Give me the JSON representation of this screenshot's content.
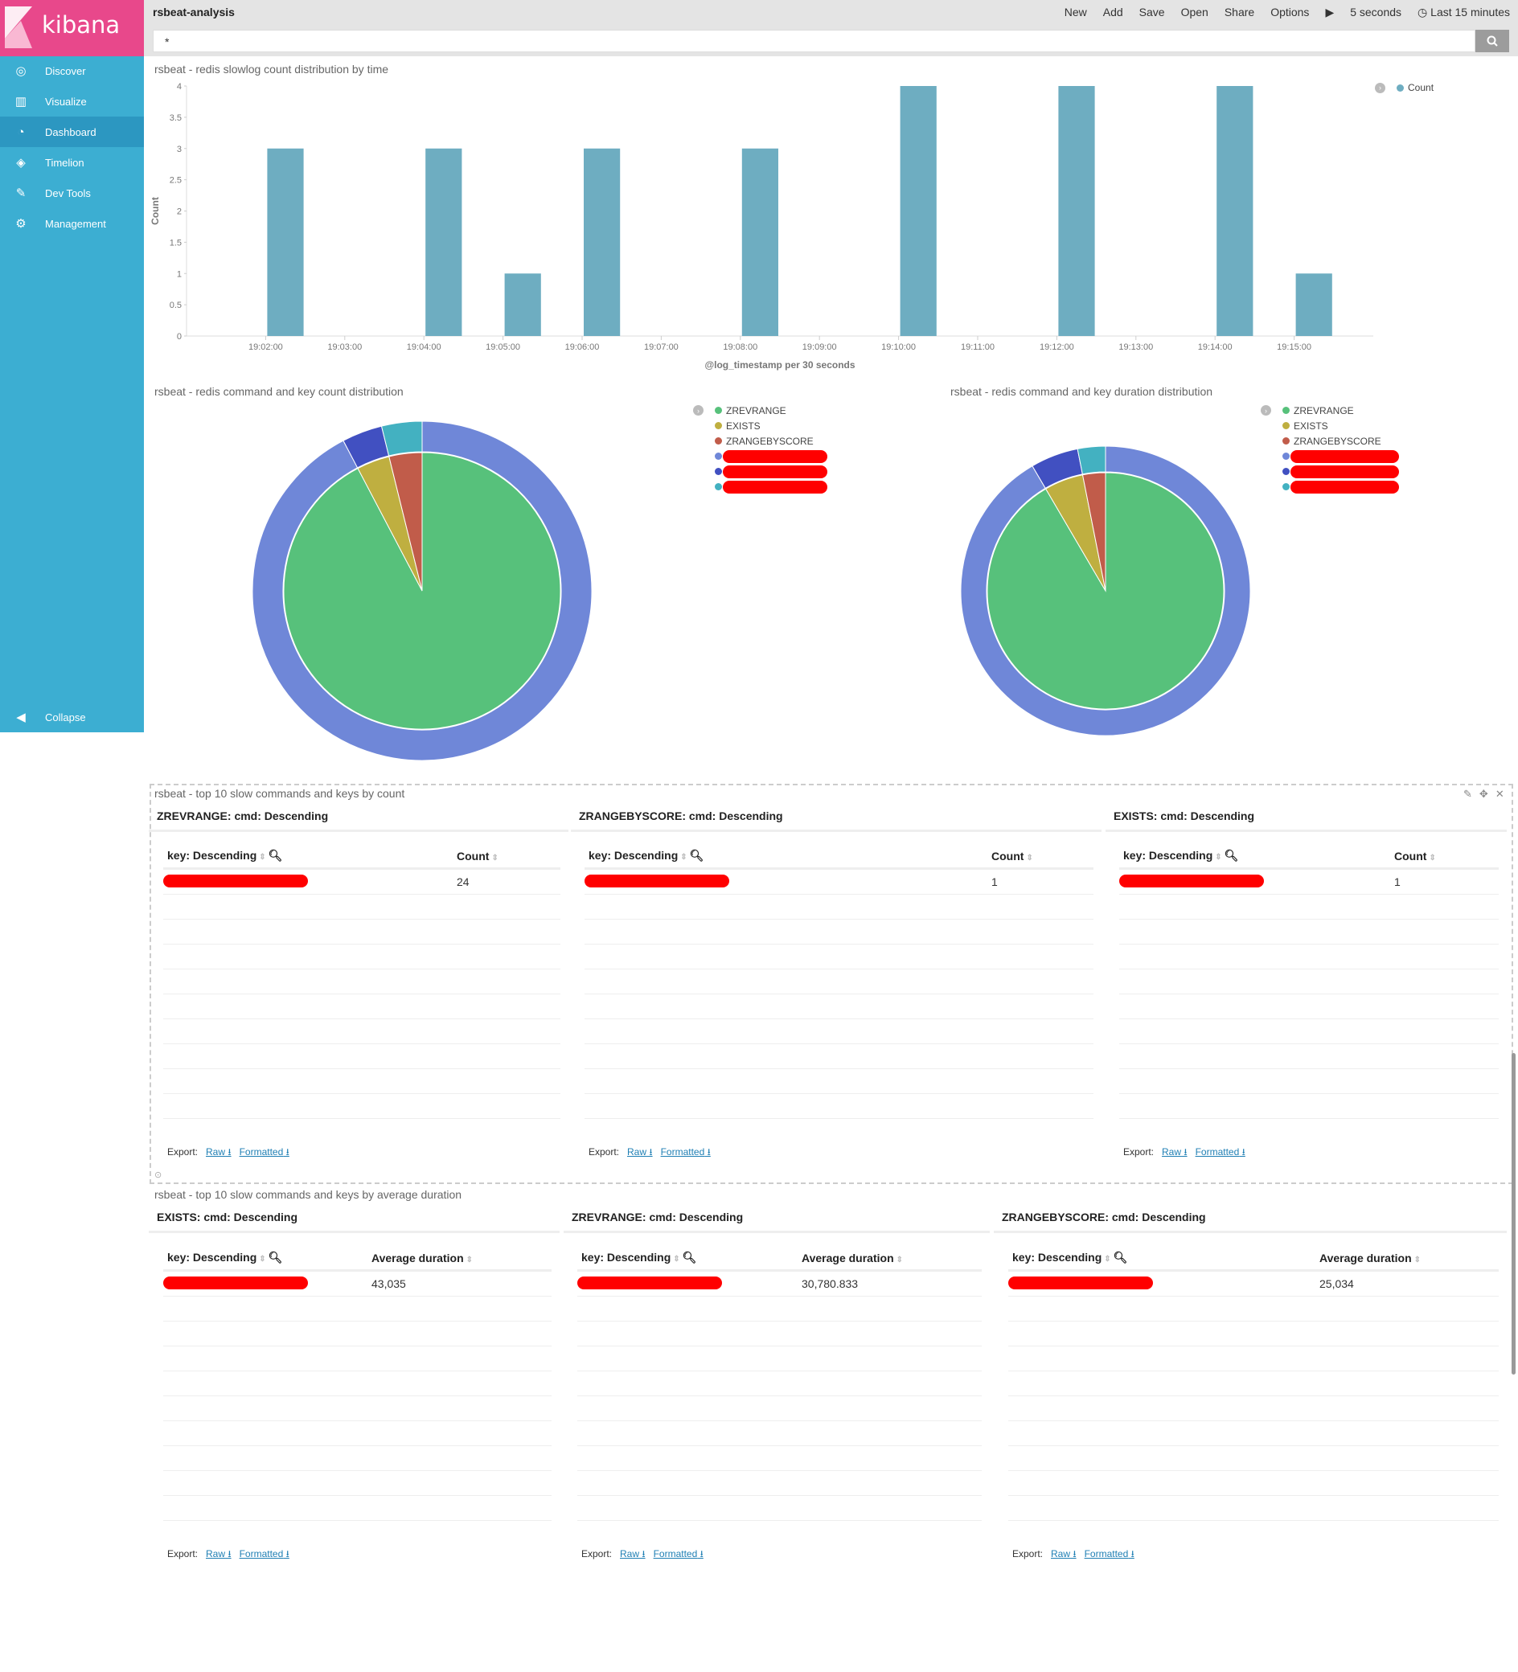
{
  "sidebar": {
    "brand": "kibana",
    "items": [
      {
        "label": "Discover",
        "icon": "compass-icon"
      },
      {
        "label": "Visualize",
        "icon": "bar-chart-icon"
      },
      {
        "label": "Dashboard",
        "icon": "dashboard-icon",
        "active": true
      },
      {
        "label": "Timelion",
        "icon": "timelion-icon"
      },
      {
        "label": "Dev Tools",
        "icon": "wrench-icon"
      },
      {
        "label": "Management",
        "icon": "gear-icon"
      }
    ],
    "collapse": "Collapse"
  },
  "header": {
    "title": "rsbeat-analysis",
    "menu": [
      "New",
      "Add",
      "Save",
      "Open",
      "Share",
      "Options"
    ],
    "refresh": "5 seconds",
    "time": "Last 15 minutes",
    "query": "*"
  },
  "colors": {
    "bar": "#6eadc1",
    "zrevrange": "#57c17b",
    "exists": "#bfaf40",
    "zrangebyscore": "#c15c4a",
    "key1": "#6f87d8",
    "key2": "#4150c1",
    "key3": "#43b1c1",
    "brand": "#e8488b",
    "sidebar": "#3caed2"
  },
  "chart_data": [
    {
      "type": "bar",
      "title": "rsbeat - redis slowlog count distribution by time",
      "xlabel": "@log_timestamp per 30 seconds",
      "ylabel": "Count",
      "legend": [
        "Count"
      ],
      "legend_position": "top-right",
      "ylim": [
        0,
        4
      ],
      "yticks": [
        "0",
        "0.5",
        "1",
        "1.5",
        "2",
        "2.5",
        "3",
        "3.5",
        "4"
      ],
      "xlim": [
        "19:01:00",
        "19:16:00"
      ],
      "xticks": [
        "19:02:00",
        "19:03:00",
        "19:04:00",
        "19:05:00",
        "19:06:00",
        "19:07:00",
        "19:08:00",
        "19:09:00",
        "19:10:00",
        "19:11:00",
        "19:12:00",
        "19:13:00",
        "19:14:00",
        "19:15:00"
      ],
      "x": [
        "19:02:00",
        "19:04:00",
        "19:05:00",
        "19:06:00",
        "19:08:00",
        "19:10:00",
        "19:12:00",
        "19:14:00",
        "19:15:00"
      ],
      "values": [
        3,
        3,
        1,
        3,
        3,
        4,
        4,
        4,
        1
      ]
    },
    {
      "type": "pie",
      "title": "rsbeat - redis command and key count distribution",
      "legend": [
        "ZREVRANGE",
        "EXISTS",
        "ZRANGEBYSCORE"
      ],
      "inner": [
        24,
        1,
        1
      ],
      "outer": [
        24,
        1,
        1
      ]
    },
    {
      "type": "pie",
      "title": "rsbeat - redis command and key duration distribution",
      "legend": [
        "ZREVRANGE",
        "EXISTS",
        "ZRANGEBYSCORE"
      ],
      "inner": [
        738740,
        43035,
        25034
      ],
      "outer": [
        738740,
        43035,
        25034
      ]
    }
  ],
  "panel_count": {
    "title": "rsbeat - top 10 slow commands and keys by count",
    "tables": [
      {
        "sub": "ZREVRANGE: cmd: Descending",
        "col1": "key: Descending",
        "col2": "Count",
        "value": "24"
      },
      {
        "sub": "ZRANGEBYSCORE: cmd: Descending",
        "col1": "key: Descending",
        "col2": "Count",
        "value": "1"
      },
      {
        "sub": "EXISTS: cmd: Descending",
        "col1": "key: Descending",
        "col2": "Count",
        "value": "1"
      }
    ]
  },
  "panel_duration": {
    "title": "rsbeat - top 10 slow commands and keys by average duration",
    "tables": [
      {
        "sub": "EXISTS: cmd: Descending",
        "col1": "key: Descending",
        "col2": "Average duration",
        "value": "43,035"
      },
      {
        "sub": "ZREVRANGE: cmd: Descending",
        "col1": "key: Descending",
        "col2": "Average duration",
        "value": "30,780.833"
      },
      {
        "sub": "ZRANGEBYSCORE: cmd: Descending",
        "col1": "key: Descending",
        "col2": "Average duration",
        "value": "25,034"
      }
    ]
  },
  "export": {
    "label": "Export:",
    "raw": "Raw",
    "formatted": "Formatted"
  }
}
